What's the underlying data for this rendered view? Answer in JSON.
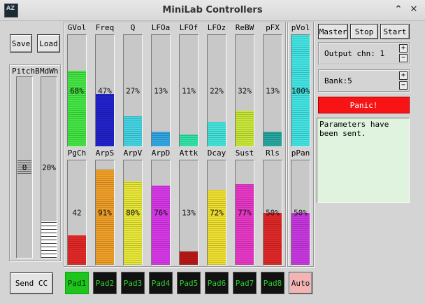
{
  "window": {
    "title": "MiniLab Controllers",
    "icon_text": "AZ"
  },
  "left": {
    "save_label": "Save",
    "load_label": "Load",
    "send_cc_label": "Send CC"
  },
  "pitch": {
    "label": "PitchB",
    "value": "0"
  },
  "modwheel": {
    "label": "MdWh",
    "value": "20%",
    "level": 0.2
  },
  "top_sliders": [
    {
      "label": "GVol",
      "value": "68%",
      "level": 0.68,
      "color": "#44e644"
    },
    {
      "label": "Freq",
      "value": "47%",
      "level": 0.47,
      "color": "#2222cc"
    },
    {
      "label": "Q",
      "value": "27%",
      "level": 0.27,
      "color": "#44d4e4"
    },
    {
      "label": "LFOa",
      "value": "13%",
      "level": 0.13,
      "color": "#33a8e4"
    },
    {
      "label": "LFOf",
      "value": "11%",
      "level": 0.11,
      "color": "#33e4a8"
    },
    {
      "label": "LFOz",
      "value": "22%",
      "level": 0.22,
      "color": "#44e4dc"
    },
    {
      "label": "ReBW",
      "value": "32%",
      "level": 0.32,
      "color": "#c8e838"
    },
    {
      "label": "pFX",
      "value": "13%",
      "level": 0.13,
      "color": "#28a8a0"
    }
  ],
  "bottom_sliders": [
    {
      "label": "PgCh",
      "value": "42",
      "level": 0.28,
      "color": "#e42828"
    },
    {
      "label": "ArpS",
      "value": "91%",
      "level": 0.91,
      "color": "#f0a028"
    },
    {
      "label": "ArpV",
      "value": "80%",
      "level": 0.8,
      "color": "#e8e838"
    },
    {
      "label": "ArpD",
      "value": "76%",
      "level": 0.76,
      "color": "#d838e8"
    },
    {
      "label": "Attk",
      "value": "13%",
      "level": 0.13,
      "color": "#b81818"
    },
    {
      "label": "Dcay",
      "value": "72%",
      "level": 0.72,
      "color": "#f0e030"
    },
    {
      "label": "Sust",
      "value": "77%",
      "level": 0.77,
      "color": "#e838c8"
    },
    {
      "label": "Rls",
      "value": "50%",
      "level": 0.5,
      "color": "#e02828"
    }
  ],
  "pvol": {
    "label": "pVol",
    "value": "100%",
    "level": 1.0,
    "color": "#44e4e4"
  },
  "ppan": {
    "label": "pPan",
    "value": "50%",
    "level": 0.5,
    "color": "#c838e0"
  },
  "transport": {
    "master": "Master",
    "stop": "Stop",
    "start": "Start"
  },
  "output_channel": {
    "label": "Output chn: 1",
    "plus": "+",
    "minus": "−"
  },
  "bank": {
    "label": "Bank:5",
    "plus": "+",
    "minus": "−"
  },
  "panic_label": "Panic!",
  "status_text": "Parameters have been sent.",
  "pads": [
    "Pad1",
    "Pad2",
    "Pad3",
    "Pad4",
    "Pad5",
    "Pad6",
    "Pad7",
    "Pad8"
  ],
  "auto_label": "Auto"
}
